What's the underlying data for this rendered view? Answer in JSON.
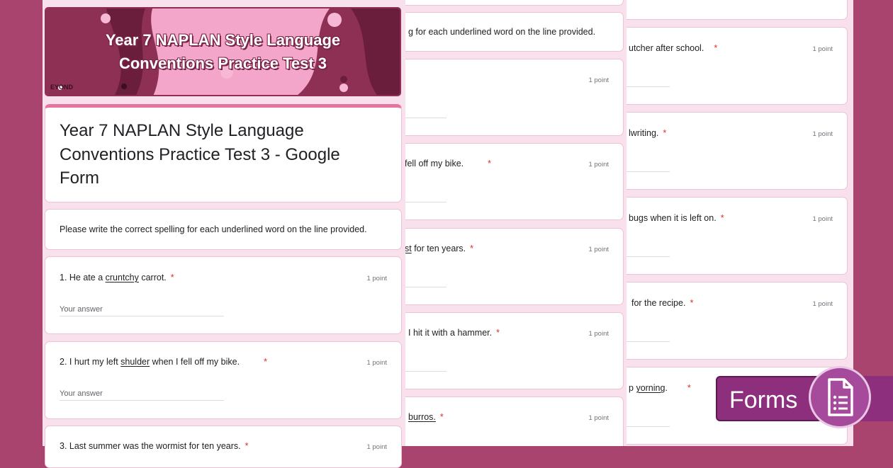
{
  "header": {
    "banner_title": "Year 7 NAPLAN Style Language Conventions Practice Test 3",
    "banner_logo": "EYOND",
    "form_title": "Year 7 NAPLAN Style Language Conventions Practice Test 3 - Google Form",
    "description": "Please write the correct spelling for each underlined word on the line provided."
  },
  "points_label": "1 point",
  "answer_placeholder": "Your answer",
  "page1": {
    "q1": {
      "pre": "1. He ate a ",
      "word": "cruntchy",
      "post": " carrot."
    },
    "q2": {
      "pre": "2. I hurt my left ",
      "word": "shulder",
      "post": " when I fell off my bike."
    },
    "q3": {
      "pre": "3. Last summer was the wormist for ten years."
    }
  },
  "page2": {
    "description_fragment": "g for each underlined word on the line provided.",
    "q2_fragment": "fell off my bike.",
    "q3_word": "st",
    "q3_post": " for ten years.",
    "q4_fragment": "I hit it with a hammer.",
    "q5_word": "burros."
  },
  "page3": {
    "q1_fragment": "utcher after school.",
    "q2_fragment": "lwriting.",
    "q3_fragment": "bugs when it is left on.",
    "q4_fragment": "for the recipe.",
    "q5_pre": "p ",
    "q5_word": "yorning",
    "q5_post": "."
  },
  "required_mark": "*",
  "badge": {
    "label": "Forms",
    "icon": "google-forms-icon"
  },
  "colors": {
    "background": "#a8446d",
    "page": "#f8e1ec",
    "accent": "#8e2f7e",
    "required": "#d93025"
  }
}
